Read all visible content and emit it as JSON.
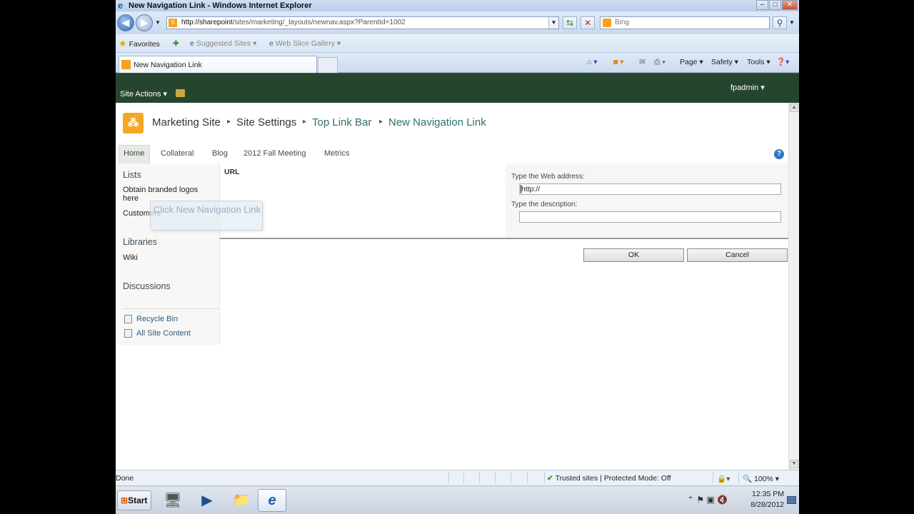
{
  "window": {
    "title": "New Navigation Link - Windows Internet Explorer",
    "minimize_label": "–",
    "maximize_label": "□",
    "close_label": "✕"
  },
  "address_bar": {
    "url_host": "http://sharepoint",
    "url_rest": "/sites/marketing/_layouts/newnav.aspx?ParentId=1002",
    "search_placeholder": "Bing"
  },
  "favorites_bar": {
    "favorites_label": "Favorites",
    "suggested_sites_label": "Suggested Sites ▾",
    "web_slice_label": "Web Slice Gallery ▾"
  },
  "tab": {
    "label": "New Navigation Link"
  },
  "command_bar": {
    "page_label": "Page ▾",
    "safety_label": "Safety ▾",
    "tools_label": "Tools ▾"
  },
  "sharepoint": {
    "site_actions_label": "Site Actions ▾",
    "user_label": "fpadmin ▾",
    "breadcrumb": [
      "Marketing Site",
      "Site Settings",
      "Top Link Bar",
      "New Navigation Link"
    ],
    "top_nav": [
      "Home",
      "Collateral",
      "Blog",
      "2012 Fall Meeting",
      "Metrics"
    ],
    "quick_launch": {
      "lists_heading": "Lists",
      "lists_items": [
        "Obtain branded logos here",
        "Customers"
      ],
      "libraries_heading": "Libraries",
      "libraries_items": [
        "Wiki"
      ],
      "discussions_heading": "Discussions",
      "recycle_bin": "Recycle Bin",
      "all_site_content": "All Site Content"
    },
    "callout_text": "Click New Navigation Link"
  },
  "form": {
    "url_section_label": "URL",
    "web_address_label": "Type the Web address:",
    "web_address_value": "http://",
    "description_label": "Type the description:",
    "description_value": "",
    "ok_label": "OK",
    "cancel_label": "Cancel"
  },
  "status_bar": {
    "done_text": "Done",
    "zone_text": "Trusted sites | Protected Mode: Off",
    "zoom_text": "100%"
  },
  "taskbar": {
    "start_label": "Start",
    "clock_time": "12:35 PM",
    "clock_date": "8/28/2012"
  },
  "colors": {
    "sharepoint_header": "#25452f",
    "breadcrumb_teal": "#2f6f6d",
    "site_logo": "#f5a623"
  }
}
